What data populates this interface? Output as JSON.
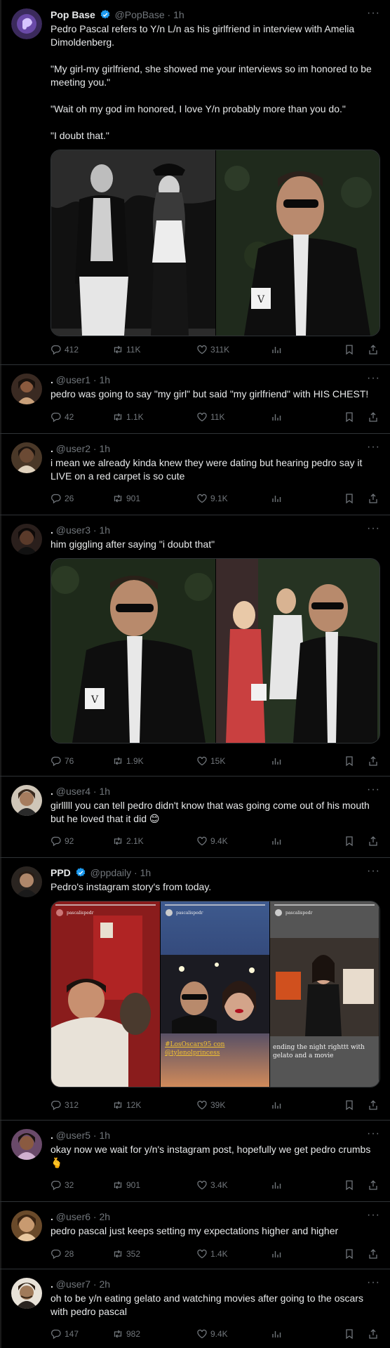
{
  "tweets": [
    {
      "name": "Pop Base",
      "handle": "@PopBase",
      "time": "1h",
      "text": "Pedro Pascal refers to Y/n L/n as his girlfriend in interview with Amelia Dimoldenberg.\n\n\"My girl-my girlfriend, she showed me your interviews so im honored to be meeting you.\"\n\n\"Wait oh my god im honored, I love Y/n probably more than you do.\"\n\n\"I doubt that.\"",
      "replies": "412",
      "retweets": "11K",
      "likes": "311K"
    },
    {
      "name": ".",
      "handle": "@user1",
      "time": "1h",
      "text": "pedro was going to say \"my girl\" but said \"my girlfriend\" with HIS CHEST!",
      "replies": "42",
      "retweets": "1.1K",
      "likes": "11K"
    },
    {
      "name": ".",
      "handle": "@user2",
      "time": "1h",
      "text": "i mean we already kinda knew they were dating but hearing pedro say it LIVE on a red carpet is so cute",
      "replies": "26",
      "retweets": "901",
      "likes": "9.1K"
    },
    {
      "name": ".",
      "handle": "@user3",
      "time": "1h",
      "text": "him giggling after saying \"i doubt that\"",
      "replies": "76",
      "retweets": "1.9K",
      "likes": "15K"
    },
    {
      "name": ".",
      "handle": "@user4",
      "time": "1h",
      "text": "girlllll you can tell pedro didn't know that was going come out of his mouth but he loved that it did 😊",
      "replies": "92",
      "retweets": "2.1K",
      "likes": "9.4K"
    },
    {
      "name": "PPD",
      "handle": "@ppdaily",
      "time": "1h",
      "text": "Pedro's instagram story's from today.",
      "replies": "312",
      "retweets": "12K",
      "likes": "39K",
      "stories": {
        "story_user": "pascalispedr",
        "tag1": "#LosOscars95 con",
        "tag2": "@tylenolprincess",
        "caption": "ending the night righttt with gelato and a movie"
      }
    },
    {
      "name": ".",
      "handle": "@user5",
      "time": "1h",
      "text": "okay now we wait for y/n's instagram post, hopefully we get pedro crumbs 🫰",
      "replies": "32",
      "retweets": "901",
      "likes": "3.4K"
    },
    {
      "name": ".",
      "handle": "@user6",
      "time": "2h",
      "text": "pedro pascal just keeps setting my expectations higher and higher",
      "replies": "28",
      "retweets": "352",
      "likes": "1.4K"
    },
    {
      "name": ".",
      "handle": "@user7",
      "time": "2h",
      "text": "oh to be y/n eating gelato and watching movies after going to the oscars with pedro pascal",
      "replies": "147",
      "retweets": "982",
      "likes": "9.4K"
    }
  ],
  "more_label": "···",
  "colors": {
    "verified": "#1d9bf0",
    "muted": "#71767b",
    "divider": "#2f3336"
  }
}
